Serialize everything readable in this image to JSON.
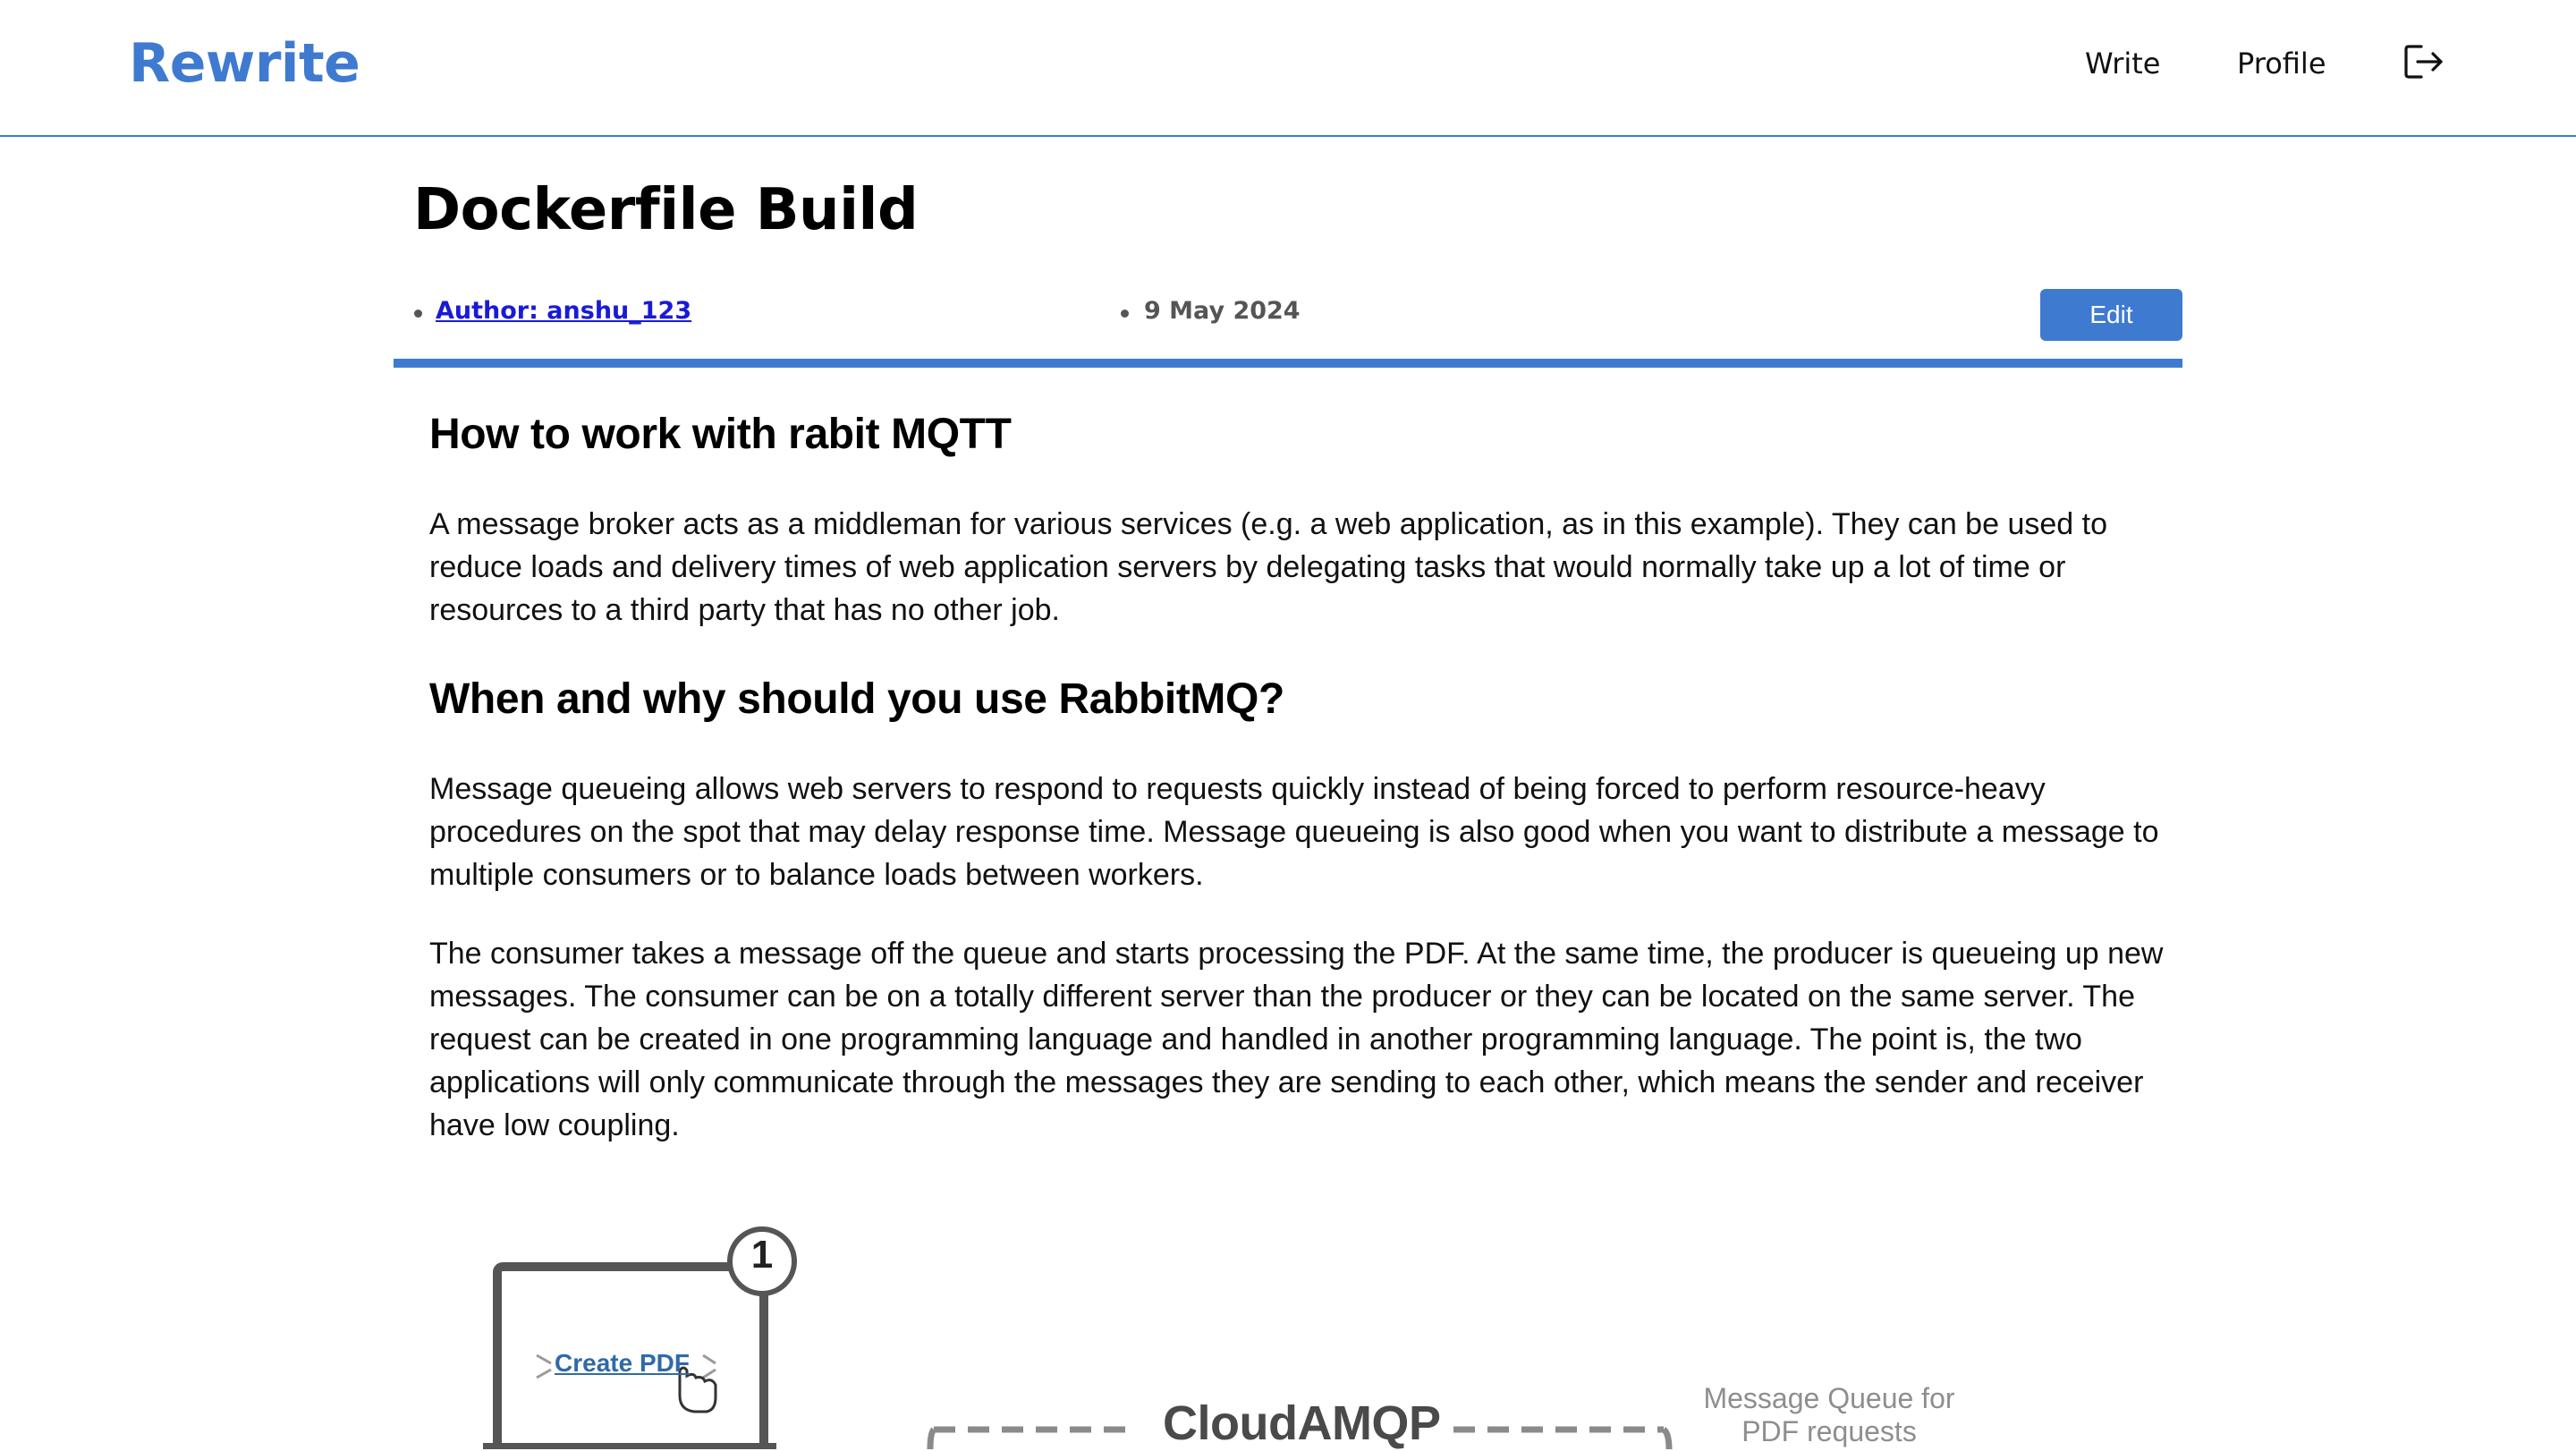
{
  "header": {
    "brand": "Rewrite",
    "nav": {
      "write": "Write",
      "profile": "Profile"
    },
    "logout_icon": "logout-icon"
  },
  "post": {
    "title": "Dockerfile Build",
    "author": "Author: anshu_123",
    "date": "9 May 2024",
    "edit_label": "Edit"
  },
  "article": {
    "heading_1": "How to work with rabit MQTT",
    "paragraph_1": "A message broker acts as a middleman for various services (e.g. a web application, as in this example). They can be used to reduce loads and delivery times of web application servers by delegating tasks that would normally take up a lot of time or resources to a third party that has no other job.",
    "heading_2": "When and why should you use RabbitMQ?",
    "paragraph_2": "Message queueing allows web servers to respond to requests quickly instead of being forced to perform resource-heavy procedures on the spot that may delay response time. Message queueing is also good when you want to distribute a message to multiple consumers or to balance loads between workers.",
    "paragraph_3": "The consumer takes a message off the queue and starts processing the PDF. At the same time, the producer is queueing up new messages. The consumer can be on a totally different server than the producer or they can be located on the same server. The request can be created in one programming language and handled in another programming language. The point is, the two applications will only communicate through the messages they are sending to each other, which means the sender and receiver have low coupling."
  },
  "diagram": {
    "step_number": "1",
    "create_pdf": "Create PDF",
    "broker_name": "CloudAMQP",
    "queue_label_line1": "Message Queue for",
    "queue_label_line2": "PDF requests"
  },
  "colors": {
    "accent": "#3f7ad1",
    "author_link": "#1a1ad6",
    "date_text": "#555555",
    "diagram_gray": "#4a4a4a"
  }
}
